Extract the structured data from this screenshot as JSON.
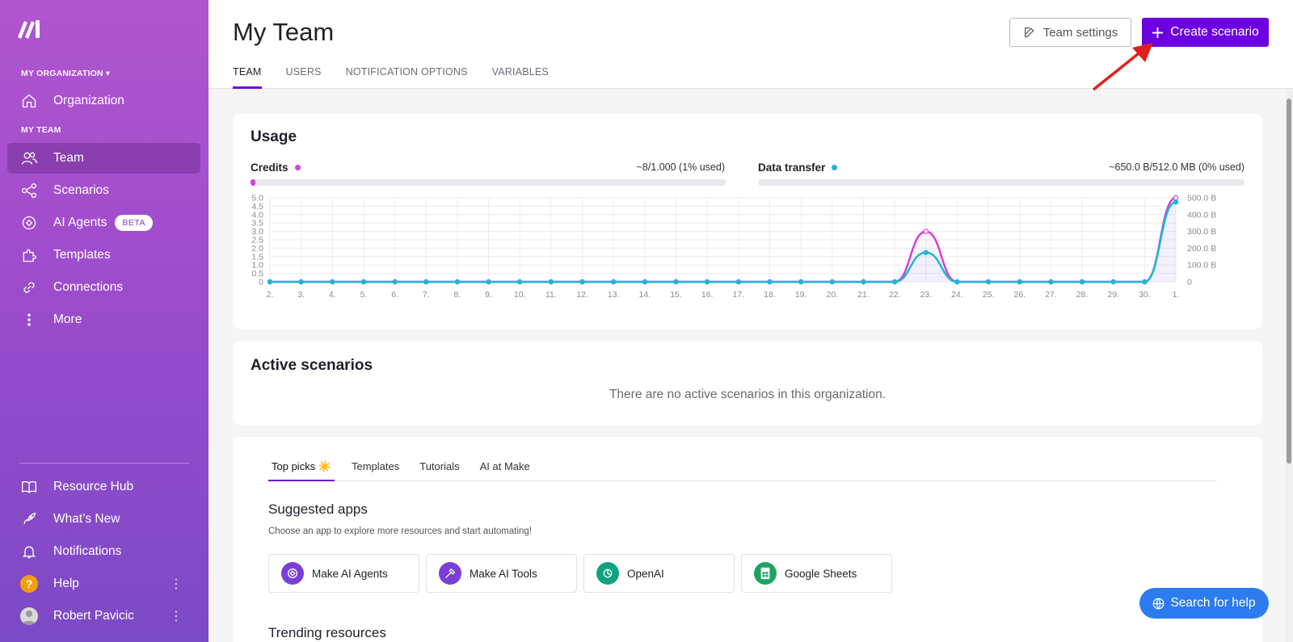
{
  "sidebar": {
    "org_section_label": "MY ORGANIZATION",
    "team_section_label": "MY TEAM",
    "items": [
      {
        "label": "Organization",
        "icon": "home-icon"
      },
      {
        "label": "Team",
        "icon": "users-icon",
        "active": true
      },
      {
        "label": "Scenarios",
        "icon": "share-icon"
      },
      {
        "label": "AI Agents",
        "icon": "ai-agent-icon",
        "badge": "BETA"
      },
      {
        "label": "Templates",
        "icon": "puzzle-icon"
      },
      {
        "label": "Connections",
        "icon": "link-icon"
      },
      {
        "label": "More",
        "icon": "more-vertical-icon"
      }
    ],
    "bottom_items": [
      {
        "label": "Resource Hub",
        "icon": "book-icon"
      },
      {
        "label": "What’s New",
        "icon": "rocket-icon"
      },
      {
        "label": "Notifications",
        "icon": "bell-icon"
      },
      {
        "label": "Help",
        "icon": "help-icon"
      },
      {
        "label": "Robert Pavicic",
        "icon": "avatar"
      }
    ],
    "help_glyph": "?"
  },
  "header": {
    "title": "My Team",
    "tabs": [
      "TEAM",
      "USERS",
      "NOTIFICATION OPTIONS",
      "VARIABLES"
    ],
    "settings_button": "Team settings",
    "create_button": "Create scenario"
  },
  "usage": {
    "title": "Usage",
    "credits_label": "Credits",
    "credits_value": "~8/1.000 (1% used)",
    "credits_fraction": 0.01,
    "transfer_label": "Data transfer",
    "transfer_value": "~650.0 B/512.0 MB (0% used)",
    "transfer_fraction": 0.0,
    "colors": {
      "credits": "#d53fd9",
      "transfer": "#1fb6d8",
      "accent": "#6d00e0"
    }
  },
  "chart_data": {
    "type": "line",
    "x": [
      "2.",
      "3.",
      "4.",
      "5.",
      "6.",
      "7.",
      "8.",
      "9.",
      "10.",
      "11.",
      "12.",
      "13.",
      "14.",
      "15.",
      "16.",
      "17.",
      "18.",
      "19.",
      "20.",
      "21.",
      "22.",
      "23.",
      "24.",
      "25.",
      "26.",
      "27.",
      "28.",
      "29.",
      "30.",
      "1."
    ],
    "y_left_ticks": [
      "0",
      "0.5",
      "1.0",
      "1.5",
      "2.0",
      "2.5",
      "3.0",
      "3.5",
      "4.0",
      "4.5",
      "5.0"
    ],
    "y_right_ticks": [
      "0",
      "100.0 B",
      "200.0 B",
      "300.0 B",
      "400.0 B",
      "500.0 B"
    ],
    "ylim_left": [
      0,
      5
    ],
    "ylim_right": [
      0,
      500
    ],
    "series": [
      {
        "name": "Credits",
        "axis": "left",
        "values": [
          0,
          0,
          0,
          0,
          0,
          0,
          0,
          0,
          0,
          0,
          0,
          0,
          0,
          0,
          0,
          0,
          0,
          0,
          0,
          0,
          0,
          3,
          0,
          0,
          0,
          0,
          0,
          0,
          0,
          5
        ]
      },
      {
        "name": "Data transfer",
        "axis": "right",
        "values": [
          0,
          0,
          0,
          0,
          0,
          0,
          0,
          0,
          0,
          0,
          0,
          0,
          0,
          0,
          0,
          0,
          0,
          0,
          0,
          0,
          0,
          175,
          0,
          0,
          0,
          0,
          0,
          0,
          0,
          475
        ]
      }
    ],
    "grid": true
  },
  "active_scenarios": {
    "title": "Active scenarios",
    "empty_text": "There are no active scenarios in this organization."
  },
  "explore": {
    "tabs": [
      "Top picks ☀️",
      "Templates",
      "Tutorials",
      "AI at Make"
    ],
    "suggested_title": "Suggested apps",
    "suggested_desc": "Choose an app to explore more resources and start automating!",
    "apps": [
      {
        "label": "Make AI Agents",
        "icon": "make-ai-agents-icon",
        "color": "#7b3fd6"
      },
      {
        "label": "Make AI Tools",
        "icon": "make-ai-tools-icon",
        "color": "#7b3fd6"
      },
      {
        "label": "OpenAI",
        "icon": "openai-icon",
        "color": "#10a37f"
      },
      {
        "label": "Google Sheets",
        "icon": "google-sheets-icon",
        "color": "#1ea362"
      }
    ],
    "trending_title": "Trending resources"
  },
  "search_help": "Search for help"
}
